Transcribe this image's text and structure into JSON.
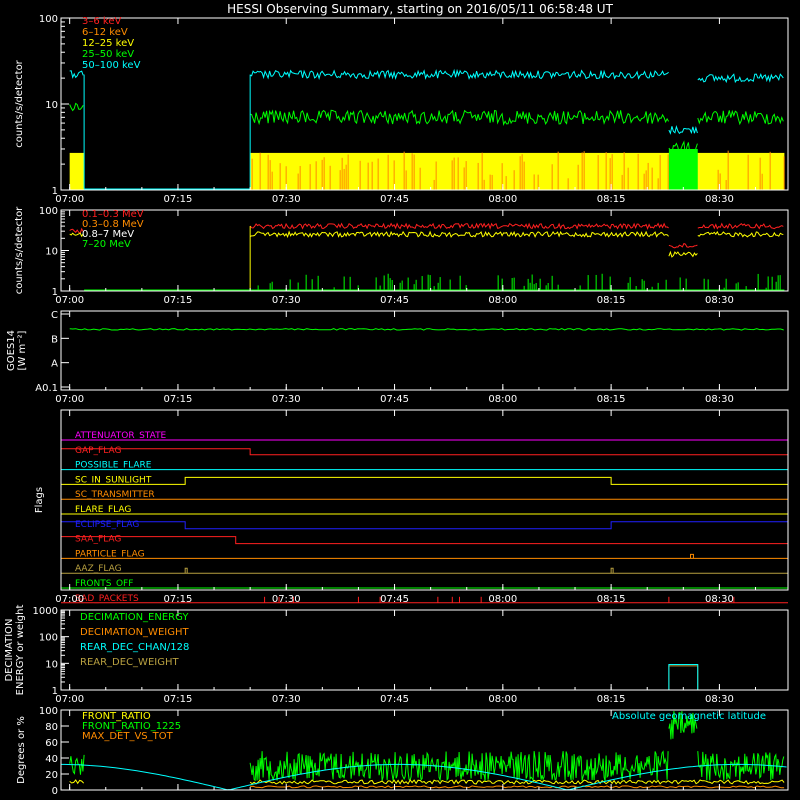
{
  "title": "HESSI Observing Summary, starting on 2016/05/11 06:58:48 UT",
  "colors": {
    "red": "#ff2020",
    "orange": "#ff8c00",
    "yellow": "#ffff00",
    "green": "#00ff00",
    "cyan": "#00ffff",
    "magenta": "#ff00ff",
    "blue": "#2020ff",
    "olive": "#b8a040",
    "white": "#ffffff",
    "gridgray": "#666666"
  },
  "time_ticks": [
    "07:00",
    "07:15",
    "07:30",
    "07:45",
    "08:00",
    "08:15",
    "08:30"
  ],
  "chart_data": [
    {
      "id": "lightcurve",
      "type": "line",
      "ylabel": "counts/s/detector",
      "yscale": "log",
      "ylim": [
        1,
        100
      ],
      "ytick_labels": [
        "1",
        "10",
        "100"
      ],
      "legend": [
        "3–6 keV",
        "6–12 keV",
        "12–25 keV",
        "25–50 keV",
        "50–100 keV"
      ],
      "legend_colors": [
        "red",
        "orange",
        "yellow",
        "green",
        "cyan"
      ],
      "segments": [
        {
          "series": "50–100 keV",
          "color": "cyan",
          "from": "07:00",
          "to": "07:02",
          "level": 22
        },
        {
          "series": "50–100 keV",
          "color": "cyan",
          "from": "07:02",
          "to": "07:25",
          "level": 1
        },
        {
          "series": "50–100 keV",
          "color": "cyan",
          "from": "07:25",
          "to": "08:23",
          "level": 22
        },
        {
          "series": "50–100 keV",
          "color": "cyan",
          "from": "08:23",
          "to": "08:27",
          "level": 5
        },
        {
          "series": "50–100 keV",
          "color": "cyan",
          "from": "08:27",
          "to": "08:39",
          "level": 20
        },
        {
          "series": "25–50 keV",
          "color": "green",
          "from": "07:00",
          "to": "07:02",
          "level": 9
        },
        {
          "series": "25–50 keV",
          "color": "green",
          "from": "07:25",
          "to": "08:23",
          "level": 7
        },
        {
          "series": "25–50 keV",
          "color": "green",
          "from": "08:23",
          "to": "08:27",
          "level": 3
        },
        {
          "series": "25–50 keV",
          "color": "green",
          "from": "08:27",
          "to": "08:39",
          "level": 7
        }
      ]
    },
    {
      "id": "gamma",
      "type": "line",
      "ylabel": "counts/s/detector",
      "yscale": "log",
      "ylim": [
        1,
        100
      ],
      "ytick_labels": [
        "1",
        "10",
        "100"
      ],
      "legend": [
        "0.1–0.3 MeV",
        "0.3–0.8 MeV",
        "0.8–7 MeV",
        "7–20 MeV"
      ],
      "legend_colors": [
        "red",
        "orange",
        "white",
        "green"
      ],
      "segments": [
        {
          "series": "0.1–0.3 MeV",
          "color": "red",
          "from": "07:00",
          "to": "07:02",
          "level": 30
        },
        {
          "series": "0.1–0.3 MeV",
          "color": "red",
          "from": "07:25",
          "to": "08:23",
          "level": 40
        },
        {
          "series": "0.1–0.3 MeV",
          "color": "red",
          "from": "08:23",
          "to": "08:27",
          "level": 13
        },
        {
          "series": "0.1–0.3 MeV",
          "color": "red",
          "from": "08:27",
          "to": "08:39",
          "level": 40
        },
        {
          "series": "0.3–0.8 MeV",
          "color": "yellow",
          "from": "07:00",
          "to": "07:02",
          "level": 25
        },
        {
          "series": "0.3–0.8 MeV",
          "color": "yellow",
          "from": "07:25",
          "to": "08:23",
          "level": 25
        },
        {
          "series": "0.3–0.8 MeV",
          "color": "yellow",
          "from": "08:23",
          "to": "08:27",
          "level": 8
        },
        {
          "series": "0.3–0.8 MeV",
          "color": "yellow",
          "from": "08:27",
          "to": "08:39",
          "level": 25
        }
      ]
    },
    {
      "id": "goes",
      "type": "line",
      "ylabel": "GOES14",
      "ylabel2": "[W m⁻²]",
      "ytick_labels": [
        "A0.1",
        "A",
        "B",
        "C"
      ],
      "series": [
        {
          "color": "green",
          "class_level": "B",
          "from": "07:00",
          "to": "08:39"
        }
      ]
    },
    {
      "id": "flags",
      "type": "table",
      "ylabel": "Flags",
      "rows": [
        {
          "label": "ATTENUATOR_STATE",
          "color": "magenta"
        },
        {
          "label": "GAP_FLAG",
          "color": "red"
        },
        {
          "label": "POSSIBLE_FLARE",
          "color": "cyan"
        },
        {
          "label": "SC_IN_SUNLIGHT",
          "color": "yellow"
        },
        {
          "label": "SC_TRANSMITTER",
          "color": "orange"
        },
        {
          "label": "FLARE_FLAG",
          "color": "yellow"
        },
        {
          "label": "ECLIPSE_FLAG",
          "color": "blue"
        },
        {
          "label": "SAA_FLAG",
          "color": "red"
        },
        {
          "label": "PARTICLE_FLAG",
          "color": "orange"
        },
        {
          "label": "AAZ_FLAG",
          "color": "olive"
        },
        {
          "label": "FRONTS_OFF",
          "color": "green"
        },
        {
          "label": "BAD_PACKETS",
          "color": "red"
        }
      ]
    },
    {
      "id": "decimation",
      "type": "line",
      "ylabel": "DECIMATION",
      "ylabel2": "ENERGY or weight",
      "yscale": "log",
      "ylim": [
        1,
        1000
      ],
      "ytick_labels": [
        "1",
        "10",
        "100",
        "1000"
      ],
      "legend": [
        "DECIMATION_ENERGY",
        "DECIMATION_WEIGHT",
        "REAR_DEC_CHAN/128",
        "REAR_DEC_WEIGHT"
      ],
      "legend_colors": [
        "green",
        "orange",
        "cyan",
        "olive"
      ]
    },
    {
      "id": "ratio",
      "type": "line",
      "ylabel": "Degrees or %",
      "ylim": [
        0,
        100
      ],
      "ytick_labels": [
        "0",
        "20",
        "40",
        "60",
        "80",
        "100"
      ],
      "legend": [
        "FRONT_RATIO",
        "FRONT_RATIO_1225",
        "MAX_DET_VS_TOT"
      ],
      "legend_colors": [
        "yellow",
        "green",
        "orange"
      ],
      "annotation": "Absolute geomagnetic latitude"
    }
  ]
}
